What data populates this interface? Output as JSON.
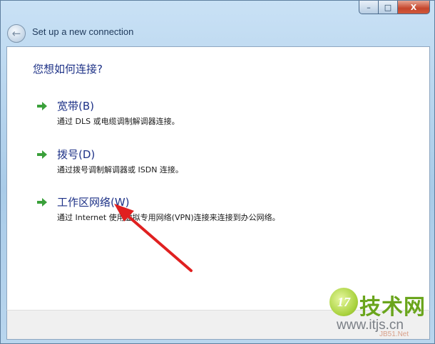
{
  "window": {
    "title": "Set up a new connection",
    "buttons": {
      "min": "–",
      "max": "□",
      "close": "X"
    }
  },
  "nav": {
    "back_icon": "back-arrow-icon",
    "back_glyph": "←"
  },
  "heading": "您想如何连接?",
  "options": [
    {
      "title": "宽带(B)",
      "desc": "通过 DLS 或电缆调制解调器连接。",
      "icon": "green-arrow-icon"
    },
    {
      "title": "拨号(D)",
      "desc": "通过拨号调制解调器或 ISDN 连接。",
      "icon": "green-arrow-icon"
    },
    {
      "title": "工作区网络(W)",
      "desc": "通过 Internet 使用虚拟专用网络(VPN)连接来连接到办公网络。",
      "icon": "green-arrow-icon"
    }
  ],
  "watermark": {
    "logo": "17",
    "name": "技术网",
    "url": "www.itjs.cn",
    "small": "JB51.Net"
  },
  "colors": {
    "accent_text": "#1e3287",
    "arrow": "#e02020",
    "option_icon": "#3aa03a"
  }
}
